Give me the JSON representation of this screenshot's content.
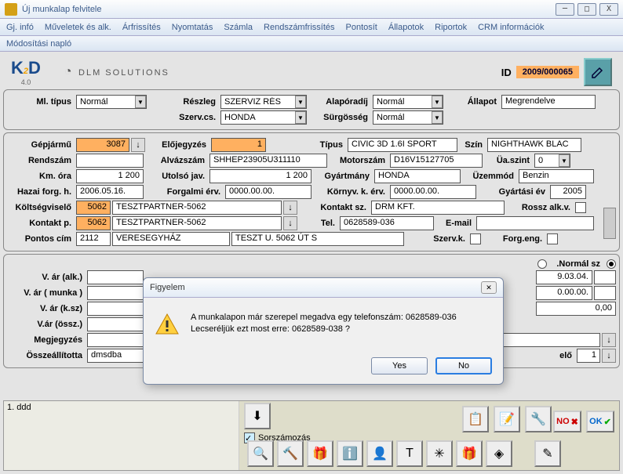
{
  "window": {
    "title": "Új munkalap felvitele"
  },
  "menu": {
    "items": [
      "Gj. infó",
      "Műveletek és alk.",
      "Árfrissítés",
      "Nyomtatás",
      "Számla",
      "Rendszámfrissítés",
      "Pontosít",
      "Állapotok",
      "Riportok",
      "CRM információk"
    ],
    "row2": "Módosítási napló"
  },
  "header": {
    "id_label": "ID",
    "id_value": "2009/000065",
    "brand_dlm": "DLM SOLUTIONS",
    "brand_k2d_ver": "4.0"
  },
  "f": {
    "ml_tipus_l": "Ml. típus",
    "ml_tipus": "Normál",
    "reszleg_l": "Részleg",
    "reszleg": "SZERVIZ RÉS",
    "alaporadij_l": "Alapóradíj",
    "alaporadij": "Normál",
    "allapot_l": "Állapot",
    "allapot": "Megrendelve",
    "szervcs_l": "Szerv.cs.",
    "szervcs": "HONDA",
    "surgosseg_l": "Sürgösség",
    "surgosseg": "Normál",
    "gepjarmu_l": "Gépjármű",
    "gepjarmu": "3087",
    "elojegyzes_l": "Előjegyzés",
    "elojegyzes": "1",
    "tipus_l": "Típus",
    "tipus": "CIVIC 3D 1.6I SPORT",
    "szin_l": "Szín",
    "szin": "NIGHTHAWK BLAC",
    "rendszam_l": "Rendszám",
    "rendszam": "",
    "alvazszam_l": "Alvázszám",
    "alvazszam": "SHHEP23905U311110",
    "motorszam_l": "Motorszám",
    "motorszam": "D16V15127705",
    "uaszint_l": "Üa.szint",
    "uaszint": "0",
    "kmora_l": "Km. óra",
    "kmora": "1 200",
    "utolsojav_l": "Utolsó jav.",
    "utolsojav": "1 200",
    "gyartmany_l": "Gyártmány",
    "gyartmany": "HONDA",
    "uzemmod_l": "Üzemmód",
    "uzemmod": "Benzin",
    "hazai_l": "Hazai forg. h.",
    "hazai": "2006.05.16.",
    "forgerv_l": "Forgalmi érv.",
    "forgerv": "0000.00.00.",
    "kornyk_l": "Környv. k. érv.",
    "kornyk": "0000.00.00.",
    "gyartasi_l": "Gyártási év",
    "gyartasi": "2005",
    "koltsegv_l": "Költségviselő",
    "koltsegv_n": "5062",
    "koltsegv_t": "TESZTPARTNER-5062",
    "kontakt_sz_l": "Kontakt sz.",
    "kontakt_sz": "DRM KFT.",
    "rossz_l": "Rossz alk.v.",
    "kontaktp_l": "Kontakt p.",
    "kontaktp_n": "5062",
    "kontaktp_t": "TESZTPARTNER-5062",
    "tel_l": "Tel.",
    "tel": "0628589-036",
    "email_l": "E-mail",
    "email": "",
    "pontos_l": "Pontos cím",
    "pontos_zip": "2112",
    "pontos_city": "VERESEGYHÁZ",
    "pontos_addr": "TESZT U. 5062 ÚT S",
    "szervk_l": "Szerv.k.",
    "forgeng_l": "Forg.eng.",
    "normal_sz_l": ".Normál sz",
    "var_alk_l": "V. ár (alk.)",
    "var_alk": "",
    "var_munka_l": "V. ár ( munka )",
    "var_munka": "",
    "var_ksz_l": "V. ár (k.sz)",
    "var_ksz": "",
    "var_ossz_l": "V.ár (össz.)",
    "var_ossz": "",
    "date1": "9.03.04.",
    "date2": "0.00.00.",
    "amount": "0,00",
    "megj_l": "Megjegyzés",
    "megj": "",
    "osszeall_l": "Összeállította",
    "osszeall": "dmsdba",
    "elo_l": "elő",
    "elo": "1"
  },
  "dialog": {
    "title": "Figyelem",
    "line1": "A munkalapon már szerepel megadva egy telefonszám: 0628589-036",
    "line2": "Lecseréljük ezt most erre: 0628589-038 ?",
    "yes": "Yes",
    "no": "No"
  },
  "list": {
    "item1": "1. ddd"
  },
  "bottom": {
    "sorszam": "Sorszámozás",
    "no": "NO",
    "ok": "OK"
  }
}
